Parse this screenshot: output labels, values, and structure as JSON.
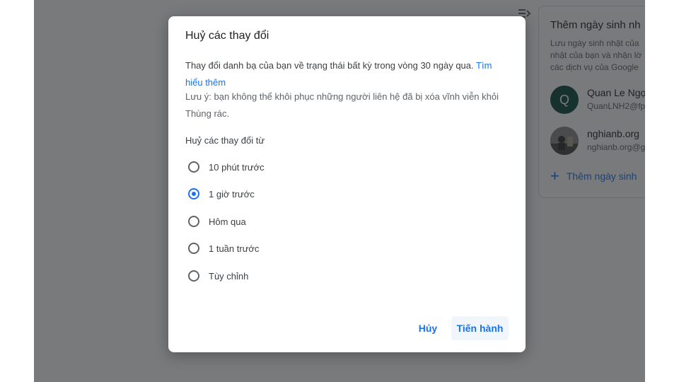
{
  "background": {
    "birthday_card": {
      "title": "Thêm ngày sinh nh",
      "description": [
        "Lưu ngày sinh nhật của",
        "nhật của bạn và nhận lờ",
        "các dịch vụ của Google"
      ],
      "contacts": [
        {
          "initial": "Q",
          "name": "Quan Le Ngọ",
          "email": "QuanLNH2@fp",
          "avatar_color": "#0b4a3c"
        },
        {
          "initial": "",
          "name": "nghianb.org",
          "email": "nghianb.org@g",
          "avatar_color": "#6b6b6b"
        }
      ],
      "add_label": "Thêm ngày sinh"
    }
  },
  "dialog": {
    "title": "Huỷ các thay đổi",
    "description": "Thay đổi danh bạ của bạn về trạng thái bất kỳ trong vòng 30 ngày qua.",
    "learn_more": "Tìm hiểu thêm",
    "note": "Lưu ý: bạn không thể khôi phục những người liên hệ đã bị xóa vĩnh viễn khỏi Thùng rác.",
    "options_label": "Huỷ các thay đổi từ",
    "options": [
      {
        "label": "10 phút trước",
        "selected": false
      },
      {
        "label": "1 giờ trước",
        "selected": true
      },
      {
        "label": "Hôm qua",
        "selected": false
      },
      {
        "label": "1 tuần trước",
        "selected": false
      },
      {
        "label": "Tùy chỉnh",
        "selected": false
      }
    ],
    "cancel_label": "Hủy",
    "confirm_label": "Tiến hành"
  },
  "colors": {
    "accent": "#1a73e8",
    "scrim": "rgba(32,33,36,0.6)"
  }
}
